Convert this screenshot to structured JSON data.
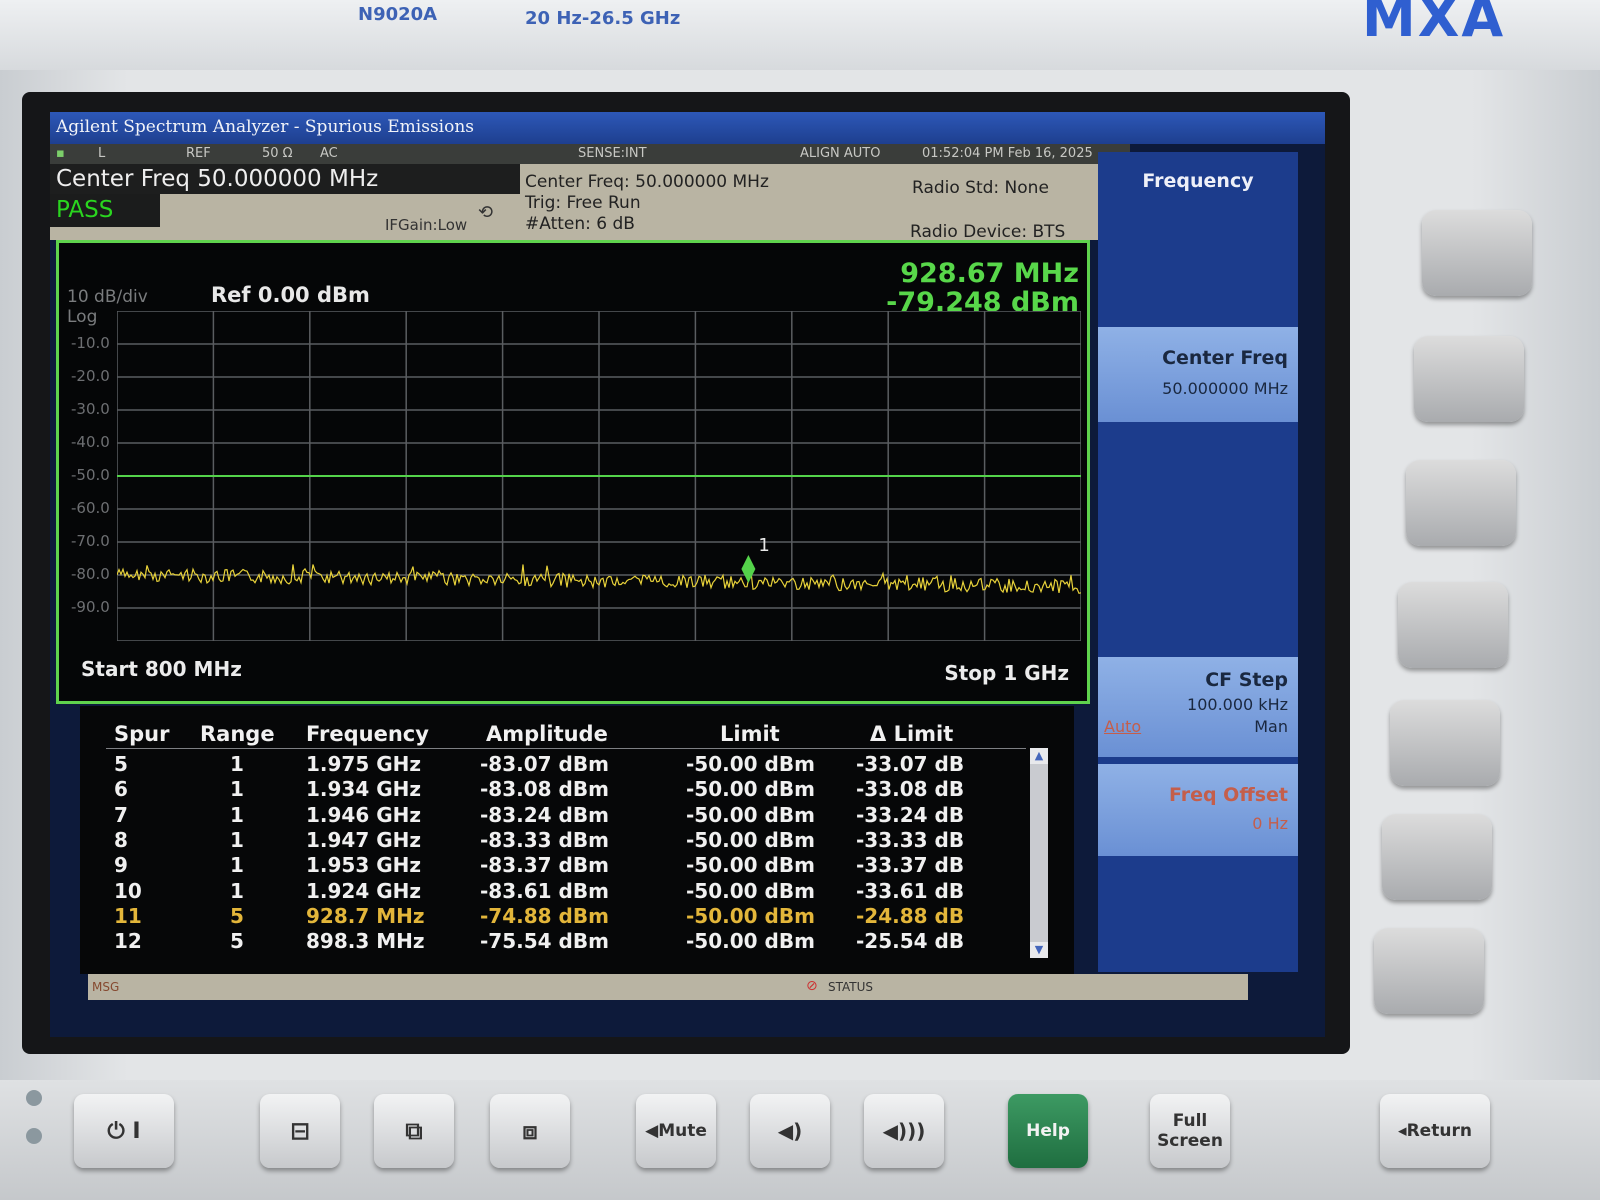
{
  "device": {
    "model": "N9020A",
    "range": "20 Hz-26.5 GHz",
    "brand": "MXA"
  },
  "window": {
    "title": "Agilent Spectrum Analyzer - Spurious Emissions"
  },
  "status": {
    "ref": "REF",
    "impedance": "50 Ω",
    "coupling": "AC",
    "sense": "SENSE:INT",
    "align": "ALIGN AUTO",
    "datetime": "01:52:04 PM Feb 16, 2025",
    "l": "L"
  },
  "header": {
    "center_freq": "Center Freq 50.000000 MHz",
    "pass": "PASS",
    "ifgain": "IFGain:Low",
    "info_cf": "Center Freq: 50.000000 MHz",
    "trig": "Trig: Free Run",
    "atten": "#Atten: 6 dB",
    "radio_std": "Radio Std: None",
    "radio_device": "Radio Device: BTS"
  },
  "plot": {
    "scale": "10 dB/div",
    "scale_type": "Log",
    "ref": "Ref 0.00 dBm",
    "marker_freq": "928.67 MHz",
    "marker_amp": "-79.248 dBm",
    "marker_label": "1",
    "start": "Start  800 MHz",
    "stop": "Stop 1 GHz",
    "y_ticks": [
      "-10.0",
      "-20.0",
      "-30.0",
      "-40.0",
      "-50.0",
      "-60.0",
      "-70.0",
      "-80.0",
      "-90.0"
    ],
    "limit_dbm": -50,
    "noise_floor_dbm": -80,
    "marker_pos_frac": 0.655,
    "colors": {
      "trace": "#e8d23a",
      "limit": "#54d34a",
      "grid": "#5a5d60"
    }
  },
  "table": {
    "headers": [
      "Spur",
      "Range",
      "Frequency",
      "Amplitude",
      "Limit",
      "Δ Limit"
    ],
    "rows": [
      {
        "spur": "5",
        "range": "1",
        "freq": "1.975 GHz",
        "amp": "-83.07 dBm",
        "limit": "-50.00 dBm",
        "dlimit": "-33.07 dB",
        "hl": false
      },
      {
        "spur": "6",
        "range": "1",
        "freq": "1.934 GHz",
        "amp": "-83.08 dBm",
        "limit": "-50.00 dBm",
        "dlimit": "-33.08 dB",
        "hl": false
      },
      {
        "spur": "7",
        "range": "1",
        "freq": "1.946 GHz",
        "amp": "-83.24 dBm",
        "limit": "-50.00 dBm",
        "dlimit": "-33.24 dB",
        "hl": false
      },
      {
        "spur": "8",
        "range": "1",
        "freq": "1.947 GHz",
        "amp": "-83.33 dBm",
        "limit": "-50.00 dBm",
        "dlimit": "-33.33 dB",
        "hl": false
      },
      {
        "spur": "9",
        "range": "1",
        "freq": "1.953 GHz",
        "amp": "-83.37 dBm",
        "limit": "-50.00 dBm",
        "dlimit": "-33.37 dB",
        "hl": false
      },
      {
        "spur": "10",
        "range": "1",
        "freq": "1.924 GHz",
        "amp": "-83.61 dBm",
        "limit": "-50.00 dBm",
        "dlimit": "-33.61 dB",
        "hl": false
      },
      {
        "spur": "11",
        "range": "5",
        "freq": "928.7 MHz",
        "amp": "-74.88 dBm",
        "limit": "-50.00 dBm",
        "dlimit": "-24.88 dB",
        "hl": true
      },
      {
        "spur": "12",
        "range": "5",
        "freq": "898.3 MHz",
        "amp": "-75.54 dBm",
        "limit": "-50.00 dBm",
        "dlimit": "-25.54 dB",
        "hl": false
      }
    ]
  },
  "msgbar": {
    "msg": "MSG",
    "status": "STATUS"
  },
  "softkeys": {
    "title": "Frequency",
    "center_freq_label": "Center Freq",
    "center_freq_value": "50.000000 MHz",
    "cf_step_label": "CF Step",
    "cf_step_value": "100.000 kHz",
    "cf_step_auto": "Auto",
    "cf_step_man": "Man",
    "freq_offset_label": "Freq Offset",
    "freq_offset_value": "0 Hz"
  },
  "front_buttons": {
    "mute": "Mute",
    "help": "Help",
    "full_screen_1": "Full",
    "full_screen_2": "Screen",
    "return": "Return"
  }
}
